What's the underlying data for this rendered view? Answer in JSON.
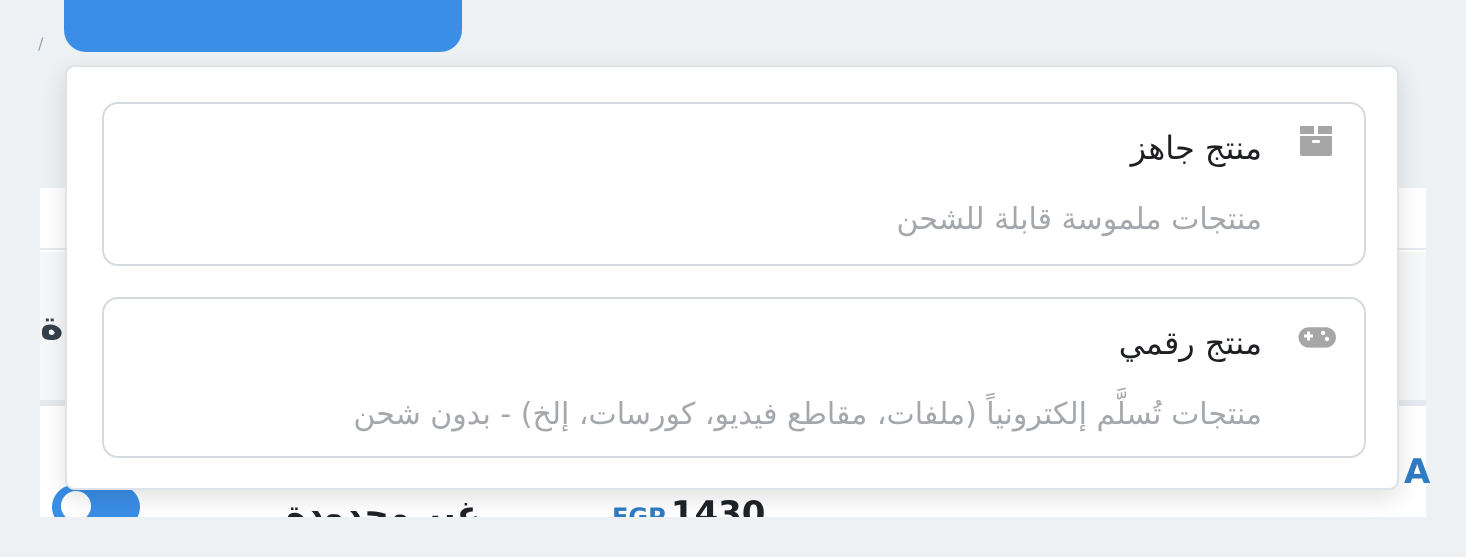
{
  "background": {
    "price_currency": "EGP",
    "price_amount": "1430",
    "bottom_text": "غير محدودة"
  },
  "dropdown": {
    "options": [
      {
        "icon": "box-icon",
        "title": "منتج جاهز",
        "description": "منتجات ملموسة قابلة للشحن"
      },
      {
        "icon": "gamepad-icon",
        "title": "منتج رقمي",
        "description": "منتجات تُسلَّم إلكترونياً (ملفات، مقاطع فيديو، كورسات، إلخ) - بدون شحن"
      }
    ]
  },
  "colors": {
    "accent": "#3a8ee6",
    "icon": "#a6a6a6",
    "title": "#1d1f22",
    "description": "#a4a8ad"
  }
}
